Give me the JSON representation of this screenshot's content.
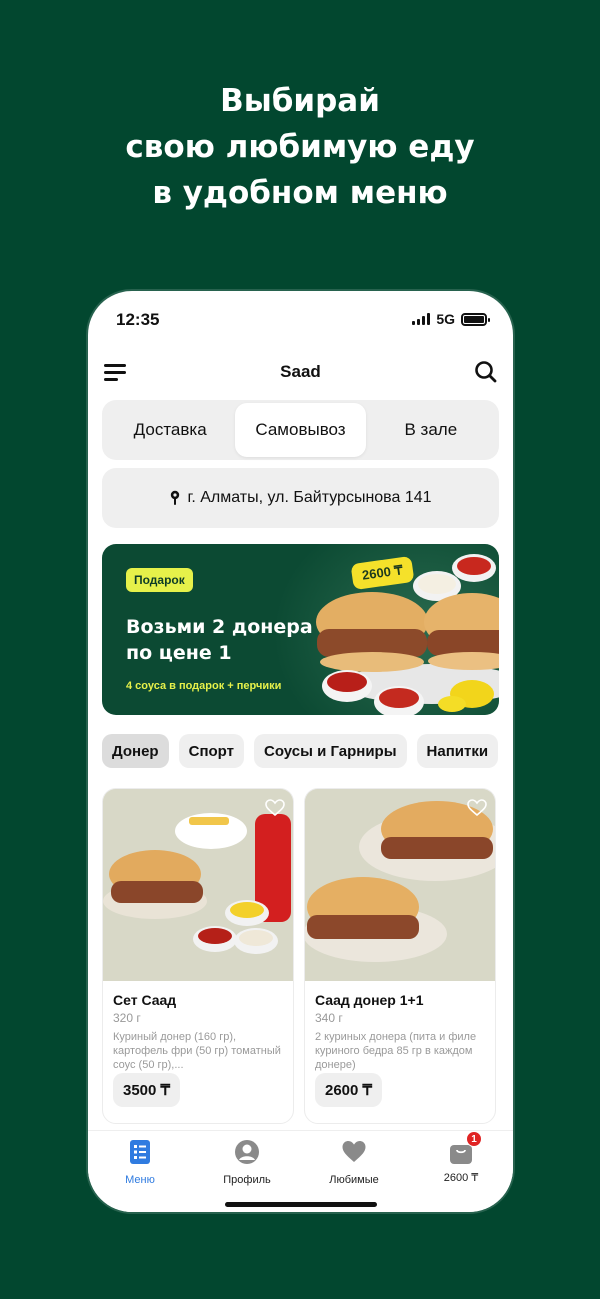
{
  "headline": {
    "line1": "Выбирай",
    "line2": "свою любимую еду",
    "line3": "в удобном меню"
  },
  "status_bar": {
    "time": "12:35",
    "network": "5G"
  },
  "app_bar": {
    "title": "Saad"
  },
  "order_modes": [
    {
      "label": "Доставка",
      "active": false
    },
    {
      "label": "Самовывоз",
      "active": true
    },
    {
      "label": "В зале",
      "active": false
    }
  ],
  "address": {
    "text": "г. Алматы, ул. Байтурсынова 141"
  },
  "promo": {
    "tag": "Подарок",
    "title_line1": "Возьми 2 донера",
    "title_line2": "по цене 1",
    "subtitle": "4 соуса в подарок + перчики",
    "price": "2600 ₸"
  },
  "categories": [
    {
      "label": "Донер",
      "active": true
    },
    {
      "label": "Спорт",
      "active": false
    },
    {
      "label": "Соусы и Гарниры",
      "active": false
    },
    {
      "label": "Напитки",
      "active": false
    }
  ],
  "products": [
    {
      "name": "Сет Саад",
      "weight": "320 г",
      "description": "Куриный донер (160 гр), картофель фри (50 гр) томатный соус (50 гр),...",
      "price": "3500 ₸"
    },
    {
      "name": "Саад донер 1+1",
      "weight": "340 г",
      "description": "2 куриных донера (пита и филе куриного бедра 85 гр в каждом донере)",
      "price": "2600 ₸"
    }
  ],
  "tab_bar": {
    "menu": "Меню",
    "profile": "Профиль",
    "favorites": "Любимые",
    "cart": "2600 ₸",
    "cart_count": "1"
  },
  "colors": {
    "brand_green": "#02472f",
    "accent_blue": "#2f7be0",
    "promo_yellow": "#e6f14a",
    "badge_red": "#e02424"
  }
}
